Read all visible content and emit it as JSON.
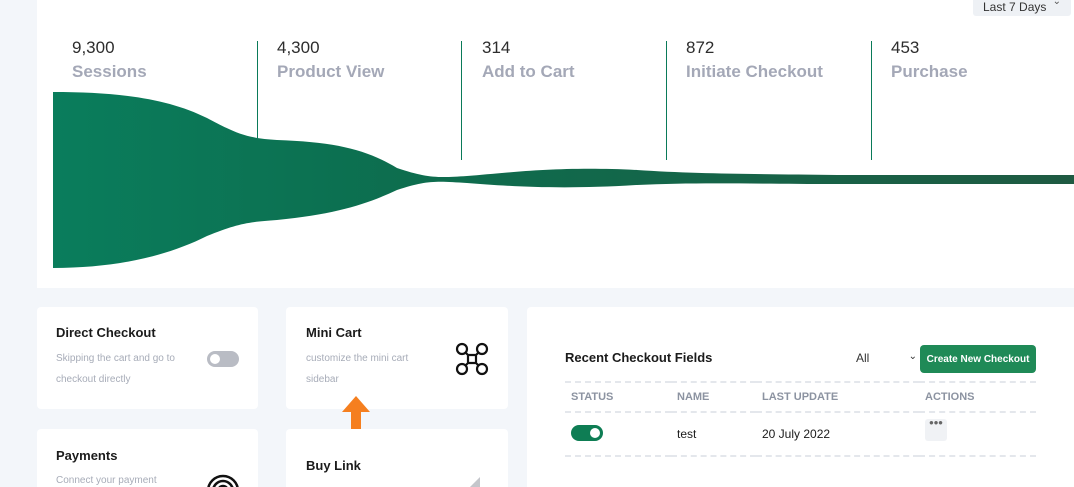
{
  "funnel": {
    "range_label": "Last 7 Days",
    "stages": [
      {
        "value": "9,300",
        "label": "Sessions"
      },
      {
        "value": "4,300",
        "label": "Product View"
      },
      {
        "value": "314",
        "label": "Add to Cart"
      },
      {
        "value": "872",
        "label": "Initiate Checkout"
      },
      {
        "value": "453",
        "label": "Purchase"
      }
    ],
    "color": "#0a7a59"
  },
  "cards": {
    "direct_checkout": {
      "title": "Direct Checkout",
      "desc_line1": "Skipping the cart and go to",
      "desc_line2": "checkout directly",
      "enabled": false
    },
    "mini_cart": {
      "title": "Mini Cart",
      "desc_line1": "customize the mini cart",
      "desc_line2": "sidebar",
      "icon": "drone-icon"
    },
    "payments": {
      "title": "Payments",
      "desc_line1": "Connect your payment",
      "icon": "fingerprint-icon"
    },
    "buy_link": {
      "title": "Buy Link",
      "icon": "link-icon"
    }
  },
  "checkout_fields": {
    "title": "Recent Checkout Fields",
    "filter_value": "All",
    "create_button": "Create New Checkout",
    "columns": [
      "STATUS",
      "NAME",
      "LAST UPDATE",
      "ACTIONS"
    ],
    "rows": [
      {
        "status": true,
        "name": "test",
        "last_update": "20 July 2022",
        "actions": "•••"
      }
    ]
  },
  "accent_color": "#1f8a57"
}
